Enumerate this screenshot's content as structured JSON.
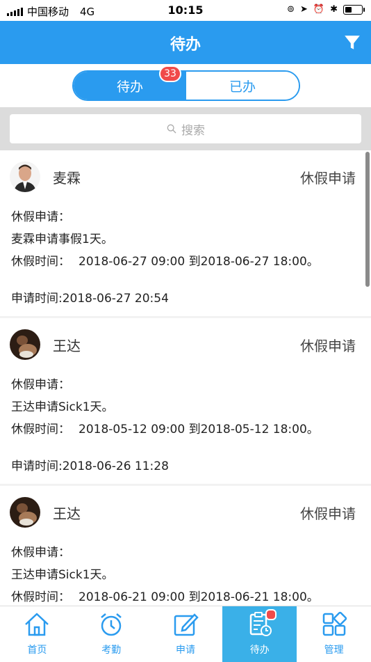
{
  "status_bar": {
    "carrier": "中国移动",
    "network": "4G",
    "time": "10:15"
  },
  "nav": {
    "title": "待办",
    "filter_icon": "filter-icon"
  },
  "segment": {
    "tabs": [
      "待办",
      "已办"
    ],
    "active_index": 0,
    "badge": "33"
  },
  "search": {
    "placeholder": "搜索"
  },
  "items": [
    {
      "name": "麦霖",
      "type": "休假申请",
      "line1": "休假申请：",
      "line2": "麦霖申请事假1天。",
      "line3_label": "休假时间：",
      "line3_value": "2018-06-27 09:00 到2018-06-27 18:00。",
      "apply_time": "申请时间:2018-06-27 20:54"
    },
    {
      "name": "王达",
      "type": "休假申请",
      "line1": "休假申请：",
      "line2": "王达申请Sick1天。",
      "line3_label": "休假时间：",
      "line3_value": "2018-05-12 09:00 到2018-05-12 18:00。",
      "apply_time": "申请时间:2018-06-26 11:28"
    },
    {
      "name": "王达",
      "type": "休假申请",
      "line1": "休假申请：",
      "line2": "王达申请Sick1天。",
      "line3_label": "休假时间：",
      "line3_value": "2018-06-21 09:00 到2018-06-21 18:00。",
      "apply_time": ""
    }
  ],
  "tabbar": {
    "tabs": [
      {
        "label": "首页",
        "icon": "home-icon"
      },
      {
        "label": "考勤",
        "icon": "clock-icon"
      },
      {
        "label": "申请",
        "icon": "edit-icon"
      },
      {
        "label": "待办",
        "icon": "todo-icon"
      },
      {
        "label": "管理",
        "icon": "grid-icon"
      }
    ],
    "active_index": 3
  },
  "colors": {
    "primary": "#2a9bef",
    "badge": "#f04a4a",
    "active_tab_bg": "#3ab0e8"
  }
}
